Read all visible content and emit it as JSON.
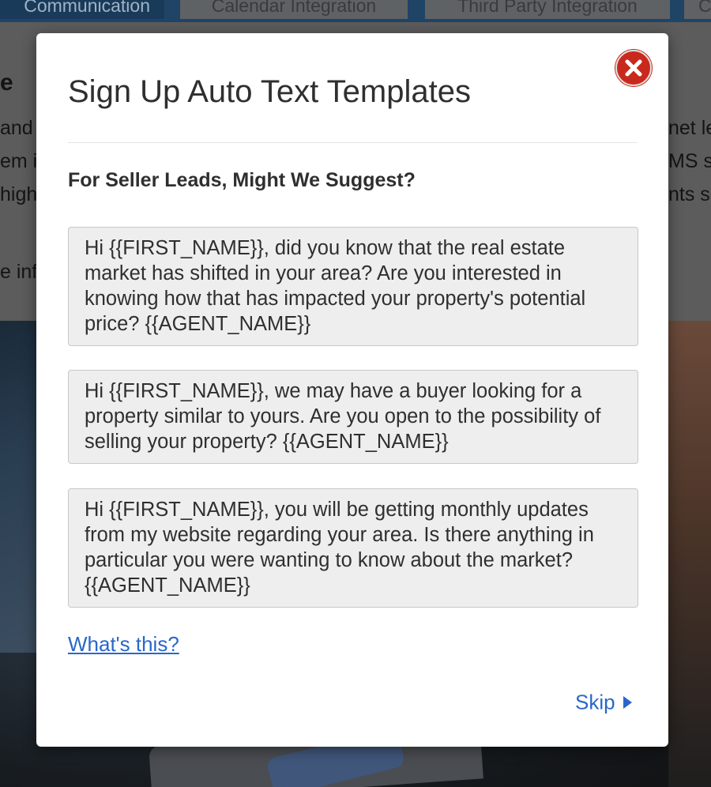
{
  "background": {
    "tabs": [
      "Communication",
      "Calendar Integration",
      "Third Party Integration",
      "C"
    ],
    "text_fragments": [
      "e",
      "and",
      "em i",
      "high",
      "e inf",
      "net le",
      "MS st",
      "nts s"
    ]
  },
  "modal": {
    "title": "Sign Up Auto Text Templates",
    "close_icon": "close-circle-icon",
    "section_heading": "For Seller Leads, Might We Suggest?",
    "templates": [
      "Hi {{FIRST_NAME}}, did you know that the real estate market has shifted in your area? Are you interested in knowing how that has impacted your property's potential price? {{AGENT_NAME}}",
      "Hi {{FIRST_NAME}}, we may have a buyer looking for a property similar to yours. Are you open to the possibility of selling your property? {{AGENT_NAME}}",
      "Hi {{FIRST_NAME}}, you will be getting monthly updates from my website regarding your area. Is there anything in particular you were wanting to know about the market?{{AGENT_NAME}}"
    ],
    "help_link": "What's this?",
    "skip_label": "Skip",
    "skip_icon": "caret-right-icon"
  },
  "colors": {
    "close_button": "#c9291d",
    "link": "#2a67c8",
    "template_bg": "#eeeeee"
  }
}
